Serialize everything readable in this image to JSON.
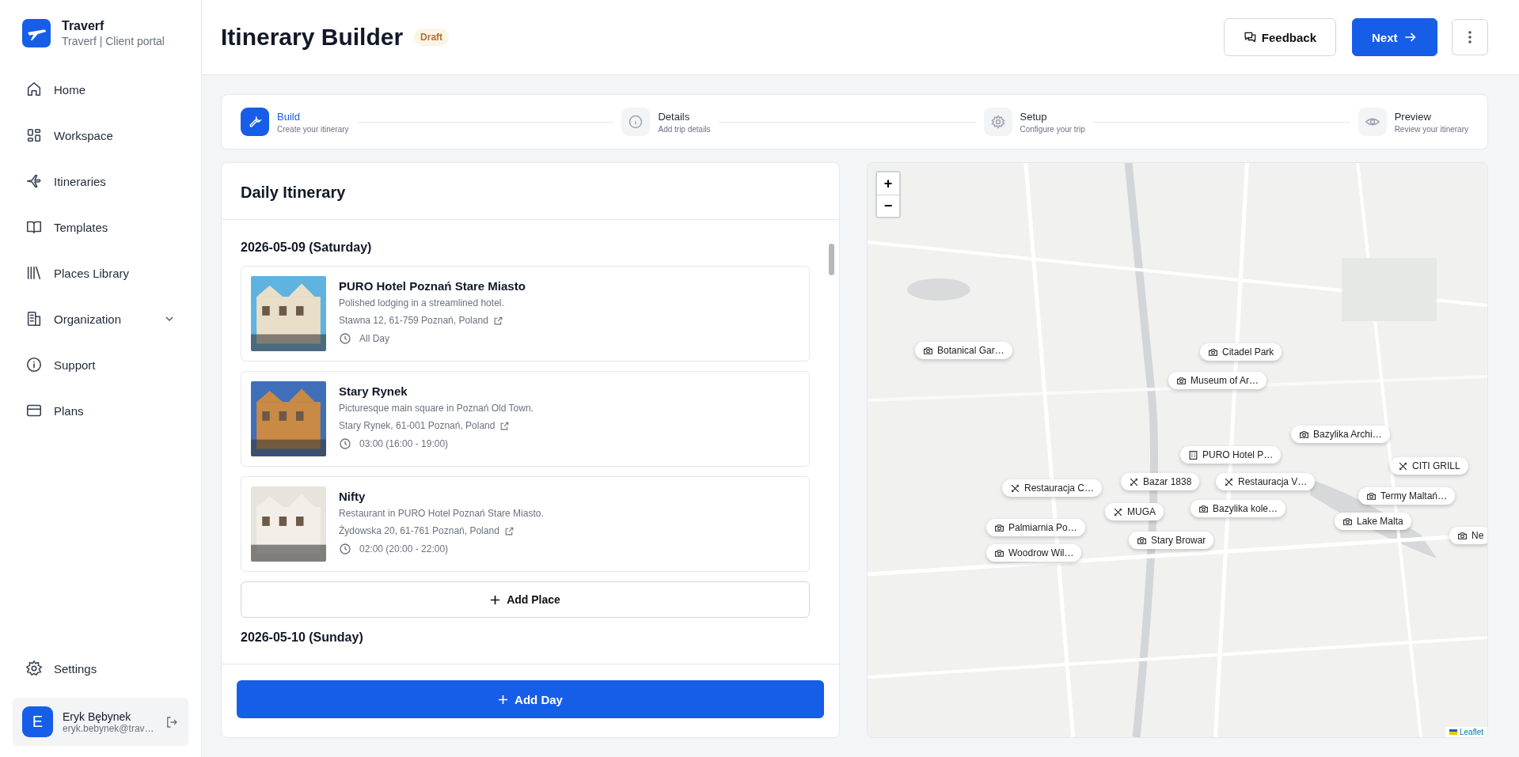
{
  "brand": {
    "name": "Traverf",
    "subtitle": "Traverf | Client portal"
  },
  "nav": [
    {
      "label": "Home",
      "kind": "link"
    },
    {
      "label": "Workspace",
      "kind": "link"
    },
    {
      "label": "Itineraries",
      "kind": "link"
    },
    {
      "label": "Templates",
      "kind": "link"
    },
    {
      "label": "Places Library",
      "kind": "link"
    },
    {
      "label": "Organization",
      "kind": "group",
      "expanded": false
    },
    {
      "label": "Support",
      "kind": "link"
    },
    {
      "label": "Plans",
      "kind": "link"
    }
  ],
  "settings": {
    "label": "Settings"
  },
  "user": {
    "initial": "E",
    "name": "Eryk Bębynek",
    "email": "eryk.bebynek@trav…"
  },
  "header": {
    "title": "Itinerary Builder",
    "badge": "Draft",
    "buttons": [
      {
        "label": "Feedback",
        "kind": "outline"
      },
      {
        "label": "Next",
        "kind": "primary"
      }
    ]
  },
  "steps": [
    {
      "title": "Build",
      "subtitle": "Create your itinerary",
      "selected": true
    },
    {
      "title": "Details",
      "subtitle": "Add trip details",
      "selected": false
    },
    {
      "title": "Setup",
      "subtitle": "Configure your trip",
      "selected": false
    },
    {
      "title": "Preview",
      "subtitle": "Review your itinerary",
      "selected": false
    }
  ],
  "itinerary": {
    "title": "Daily Itinerary",
    "days": [
      {
        "date": "2026-05-09 (Saturday)",
        "places": [
          {
            "name": "PURO Hotel Poznań Stare Miasto",
            "description": "Polished lodging in a streamlined hotel.",
            "address": "Stawna 12, 61-759 Poznań, Poland",
            "time": "All Day"
          },
          {
            "name": "Stary Rynek",
            "description": "Picturesque main square in Poznań Old Town.",
            "address": "Stary Rynek, 61-001 Poznań, Poland",
            "time": "03:00 (16:00 - 19:00)"
          },
          {
            "name": "Nifty",
            "description": "Restaurant in PURO Hotel Poznań Stare Miasto.",
            "address": "Żydowska 20, 61-761 Poznań, Poland",
            "time": "02:00 (20:00 - 22:00)"
          }
        ],
        "add_label": "Add Place"
      },
      {
        "date": "2026-05-10 (Sunday)"
      }
    ],
    "add_day": "Add Day"
  },
  "map": {
    "zoom_in": "+",
    "zoom_out": "−",
    "attribution": "Leaflet",
    "markers": [
      {
        "label": "Citadel Park",
        "kind": "sight"
      },
      {
        "label": "Museum of Ar…",
        "kind": "sight"
      },
      {
        "label": "Botanical Gar…",
        "kind": "sight"
      },
      {
        "label": "Bazylika Archi…",
        "kind": "sight"
      },
      {
        "label": "PURO Hotel P…",
        "kind": "hotel"
      },
      {
        "label": "Bazar 1838",
        "kind": "restaurant"
      },
      {
        "label": "Restauracja V…",
        "kind": "restaurant"
      },
      {
        "label": "Restauracja C…",
        "kind": "restaurant"
      },
      {
        "label": "MUGA",
        "kind": "restaurant"
      },
      {
        "label": "Bazylika kole…",
        "kind": "sight"
      },
      {
        "label": "Palmiarnia Po…",
        "kind": "sight"
      },
      {
        "label": "Stary Browar",
        "kind": "sight"
      },
      {
        "label": "Woodrow Wil…",
        "kind": "sight"
      },
      {
        "label": "CITI GRILL",
        "kind": "restaurant"
      },
      {
        "label": "Termy Maltań…",
        "kind": "sight"
      },
      {
        "label": "Lake Malta",
        "kind": "sight"
      },
      {
        "label": "Ne",
        "kind": "sight"
      }
    ]
  }
}
